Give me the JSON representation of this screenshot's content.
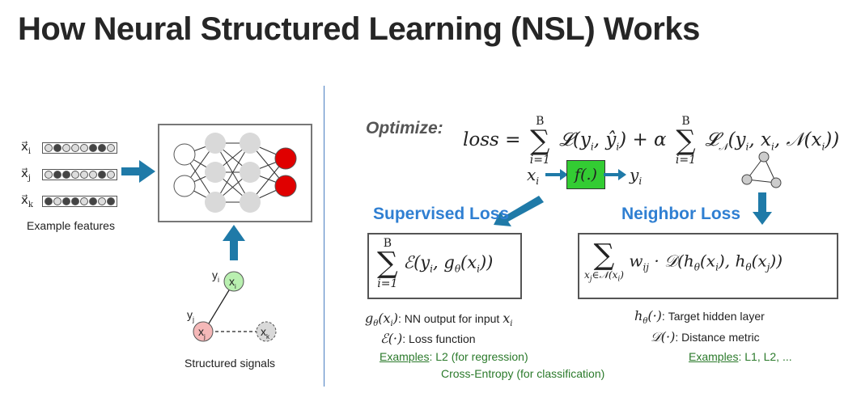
{
  "title": "How Neural Structured Learning (NSL) Works",
  "left": {
    "features": [
      {
        "label": "x",
        "sub": "i",
        "dots": [
          0,
          1,
          0,
          0,
          0,
          1,
          1,
          0
        ]
      },
      {
        "label": "x",
        "sub": "j",
        "dots": [
          0,
          1,
          1,
          0,
          0,
          0,
          1,
          0
        ]
      },
      {
        "label": "x",
        "sub": "k",
        "dots": [
          1,
          0,
          1,
          1,
          0,
          1,
          0,
          1
        ]
      }
    ],
    "example_features": "Example features",
    "structured_signals": "Structured signals",
    "graph": {
      "yi": "y",
      "yi_sub": "i",
      "yj": "y",
      "yj_sub": "j",
      "xi": "x",
      "xi_sub": "i",
      "xj": "x",
      "xj_sub": "j",
      "xk": "x",
      "xk_sub": "k"
    }
  },
  "right": {
    "optimize": "Optimize:",
    "loss_word": "loss",
    "eq1_sum_top": "B",
    "eq1_sum_bot": "i=1",
    "eq1_term1": "𝓛(y",
    "eq1_alpha": "+ α",
    "eq1_term2": "𝓛",
    "flow_x": "x",
    "flow_x_sub": "i",
    "flow_f": "f(.)",
    "flow_y": "y",
    "flow_y_sub": "i",
    "supervised_head": "Supervised Loss",
    "neighbor_head": "Neighbor Loss",
    "sup_box_top": "B",
    "sup_box_bot": "i=1",
    "sup_box_expr": "ℰ(y",
    "nbr_box_bot": "x",
    "nbr_box_expr": "w",
    "def1_math": "g",
    "def1_text": ": NN output for input ",
    "def2_math": "ℰ(·)",
    "def2_text": ": Loss function",
    "examples_label": "Examples",
    "examples_sup_1": ": L2 (for regression)",
    "examples_sup_2": "Cross-Entropy (for classification)",
    "def3_math": "h",
    "def3_text": ": Target hidden layer",
    "def4_math": "𝒟(·)",
    "def4_text": ": Distance metric",
    "examples_nbr": ": L1, L2, ..."
  },
  "colors": {
    "arrow": "#1f7aa8",
    "node_gray": "#d9d9d9",
    "node_red": "#e00000",
    "node_green": "#b9f0b0",
    "node_pink": "#f5b8b8",
    "f_box": "#33cc33",
    "title": "#262626",
    "head": "#2f7fd2"
  }
}
